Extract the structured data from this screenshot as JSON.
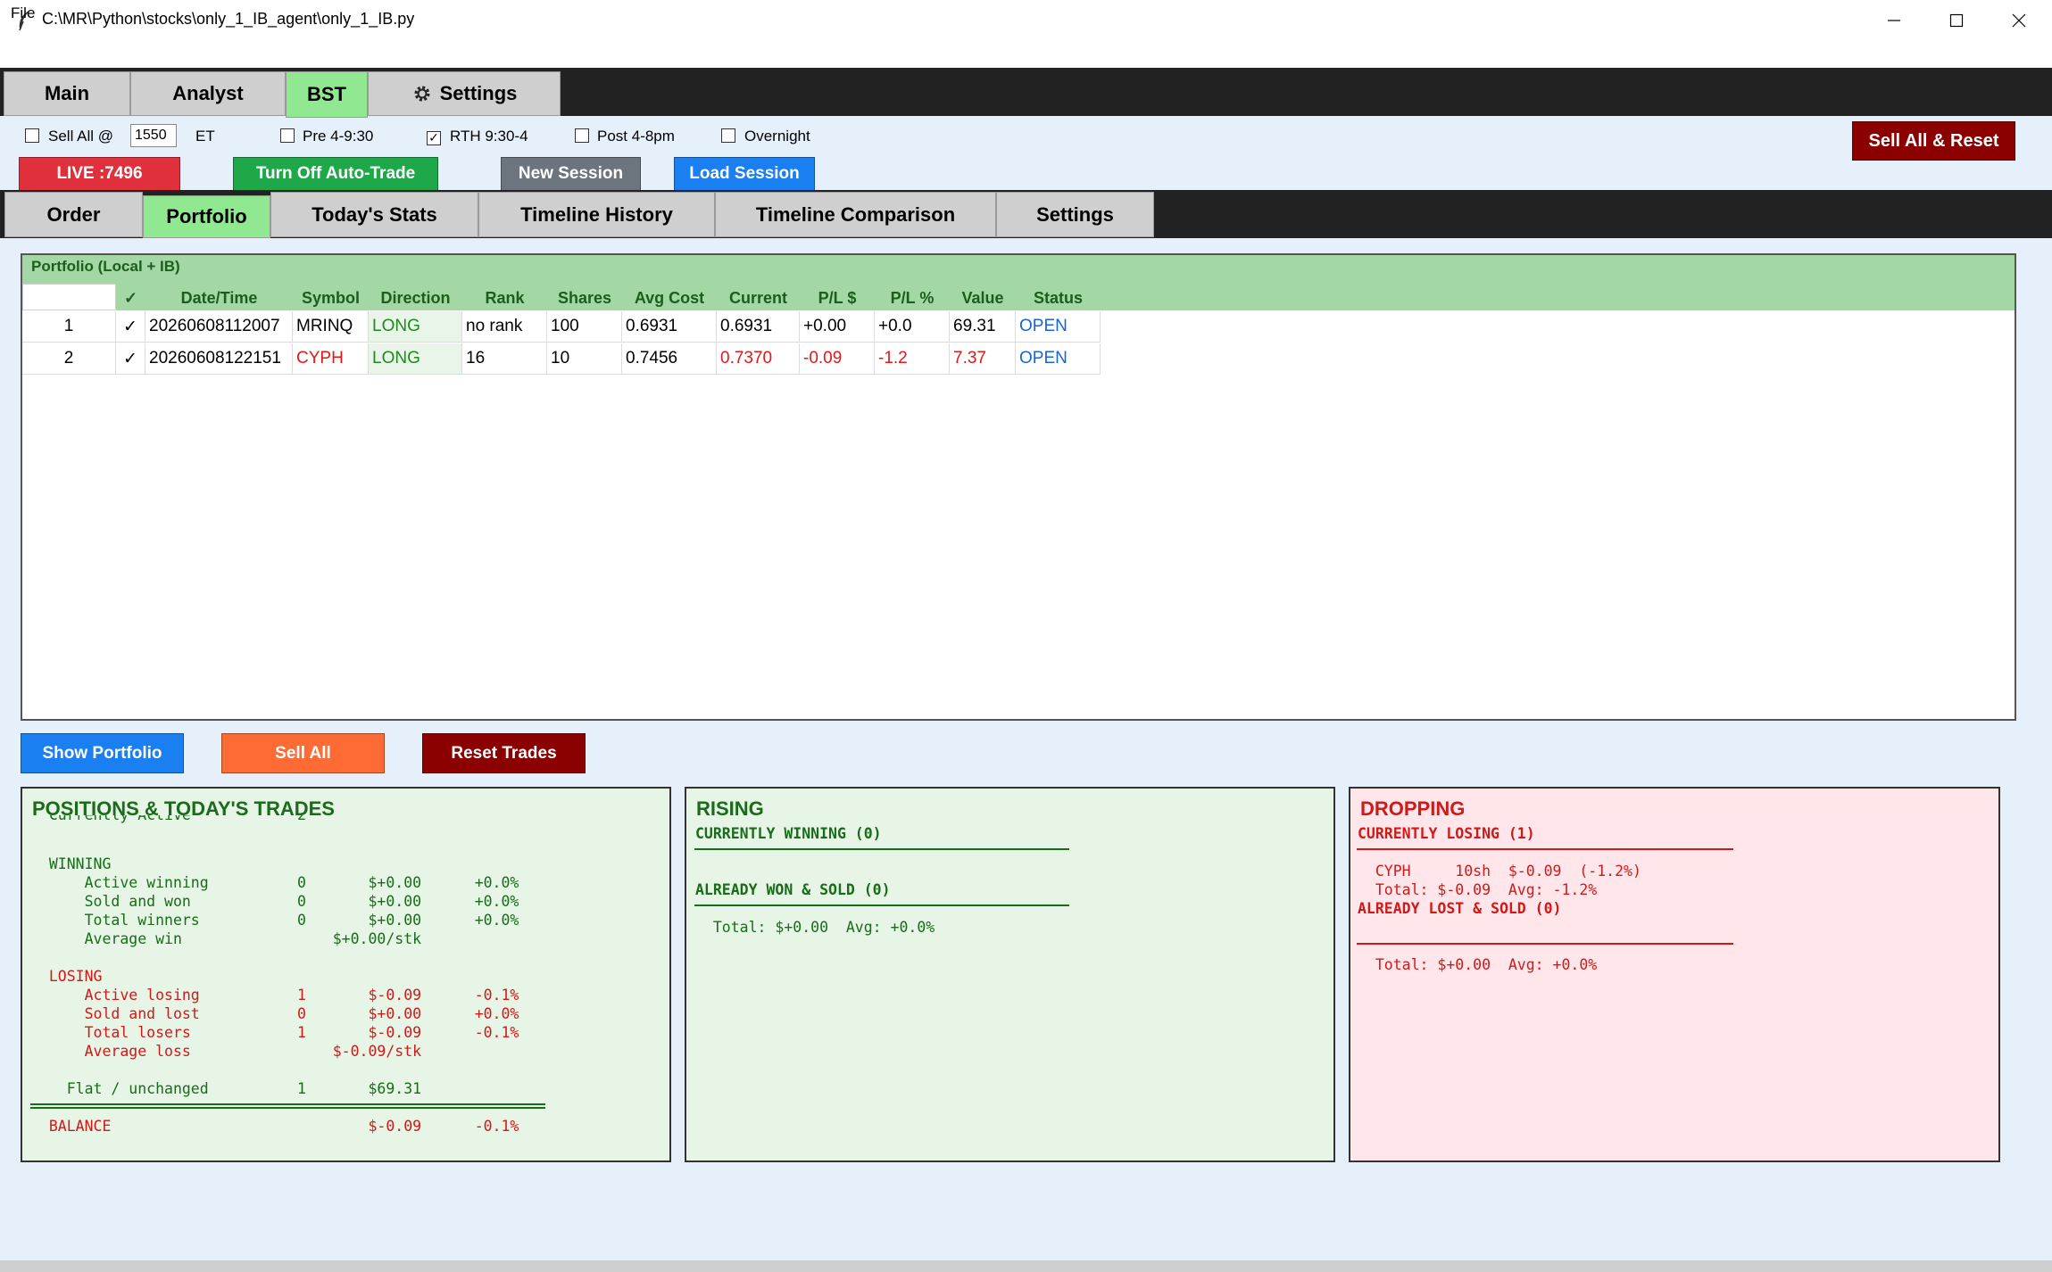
{
  "window": {
    "title": "C:\\MR\\Python\\stocks\\only_1_IB_agent\\only_1_IB.py",
    "menu": [
      "File"
    ]
  },
  "top_tabs": [
    {
      "label": "Main"
    },
    {
      "label": "Analyst"
    },
    {
      "label": "BST",
      "active": true
    },
    {
      "label": "Settings",
      "icon": "gear-icon"
    }
  ],
  "controls": {
    "sell_all_at_label": "Sell All @",
    "sell_all_at_time": "1550",
    "et_label": "ET",
    "sessions": [
      {
        "label": "Pre 4-9:30",
        "checked": false
      },
      {
        "label": "RTH 9:30-4",
        "checked": true
      },
      {
        "label": "Post 4-8pm",
        "checked": false
      },
      {
        "label": "Overnight",
        "checked": false
      }
    ],
    "sell_all_reset": "Sell All & Reset",
    "live_label": "LIVE :7496",
    "auto_trade_label": "Turn Off Auto-Trade",
    "new_session": "New Session",
    "load_session": "Load Session"
  },
  "inner_tabs": [
    {
      "label": "Order"
    },
    {
      "label": "Portfolio",
      "active": true
    },
    {
      "label": "Today's Stats"
    },
    {
      "label": "Timeline History"
    },
    {
      "label": "Timeline Comparison"
    },
    {
      "label": "Settings"
    }
  ],
  "portfolio": {
    "caption": "Portfolio (Local + IB)",
    "columns": [
      "✓",
      "Date/Time",
      "Symbol",
      "Direction",
      "Rank",
      "Shares",
      "Avg Cost",
      "Current",
      "P/L $",
      "P/L %",
      "Value",
      "Status"
    ],
    "rows": [
      {
        "index": "1",
        "check": "✓",
        "datetime": "20260608112007",
        "symbol": "MRINQ",
        "direction": "LONG",
        "rank": "no rank",
        "shares": "100",
        "avg_cost": "0.6931",
        "current": "0.6931",
        "pl_usd": "+0.00",
        "pl_pct": "+0.0",
        "value": "69.31",
        "status": "OPEN"
      },
      {
        "index": "2",
        "check": "✓",
        "datetime": "20260608122151",
        "symbol": "CYPH",
        "direction": "LONG",
        "rank": "16",
        "shares": "10",
        "avg_cost": "0.7456",
        "current": "0.7370",
        "pl_usd": "-0.09",
        "pl_pct": "-1.2",
        "value": "7.37",
        "status": "OPEN"
      }
    ]
  },
  "actions": {
    "show_portfolio": "Show Portfolio",
    "sell_all": "Sell All",
    "reset_trades": "Reset Trades"
  },
  "positions_panel": {
    "title": "POSITIONS & TODAY'S TRADES",
    "currently_active": "  Currently Active            2",
    "winning_header": "  WINNING",
    "winning_lines": [
      "      Active winning          0       $+0.00      +0.0%",
      "      Sold and won            0       $+0.00      +0.0%",
      "      Total winners           0       $+0.00      +0.0%",
      "      Average win                 $+0.00/stk"
    ],
    "losing_header": "  LOSING",
    "losing_lines": [
      "      Active losing           1       $-0.09      -0.1%",
      "      Sold and lost           0       $+0.00      +0.0%",
      "      Total losers            1       $-0.09      -0.1%",
      "      Average loss                $-0.09/stk"
    ],
    "flat_line": "    Flat / unchanged          1       $69.31",
    "balance_line": "  BALANCE                             $-0.09      -0.1%"
  },
  "rising_panel": {
    "title": "RISING",
    "currently_winning": "CURRENTLY WINNING (0)",
    "already_won": "ALREADY WON & SOLD (0)",
    "total": "  Total: $+0.00  Avg: +0.0%"
  },
  "dropping_panel": {
    "title": "DROPPING",
    "currently_losing": "CURRENTLY LOSING (1)",
    "position_line": "  CYPH     10sh  $-0.09  (-1.2%)",
    "total_line": "  Total: $-0.09  Avg: -1.2%",
    "already_lost": "ALREADY LOST & SOLD (0)",
    "lost_total": "  Total: $+0.00  Avg: +0.0%"
  },
  "colors": {
    "tab_active": "#90e890",
    "live_red": "#e0303c",
    "auto_trade_green": "#1fa84a",
    "new_session_gray": "#6c757d",
    "load_session_blue": "#1a7ff0",
    "sell_reset_darkred": "#8b0000",
    "show_portfolio_blue": "#1a7ff0",
    "sell_all_orange": "#ff6b35",
    "reset_trades_darkred": "#8b0000",
    "panel_green_bg": "#e6f5e6",
    "panel_red_bg": "#ffe6ea"
  }
}
